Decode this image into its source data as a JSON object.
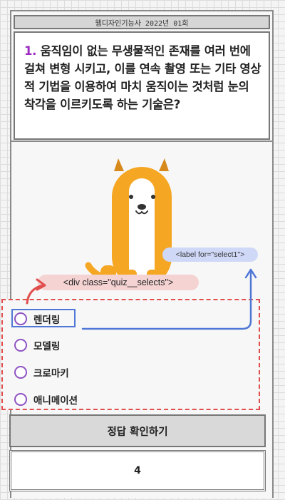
{
  "header": {
    "title": "웹디자인기능사 2022년 01회"
  },
  "question": {
    "number": "1.",
    "text": " 움직임이 없는 무생물적인 존재를 여러 번에 걸쳐 변형 시키고, 이를 연속 촬영 또는 기타 영상적 기법을 이용하여 마치 움직이는 것처럼 눈의 착각을 이르키도록 하는 기술은?"
  },
  "annotations": {
    "label_tag": "<label for=\"select1\">",
    "div_tag": "<div class=\"quiz__selects\">"
  },
  "options": [
    {
      "label": "렌더링"
    },
    {
      "label": "모델링"
    },
    {
      "label": "크로마키"
    },
    {
      "label": "애니메이션"
    }
  ],
  "check_button": {
    "label": "정답 확인하기"
  },
  "answer": {
    "value": "4"
  },
  "colors": {
    "question_number": "#9b2bc0",
    "radio": "#8e52c3",
    "dog_orange": "#f5a623",
    "dashed_border": "#e14e4e",
    "highlight_border": "#4f78d6"
  }
}
